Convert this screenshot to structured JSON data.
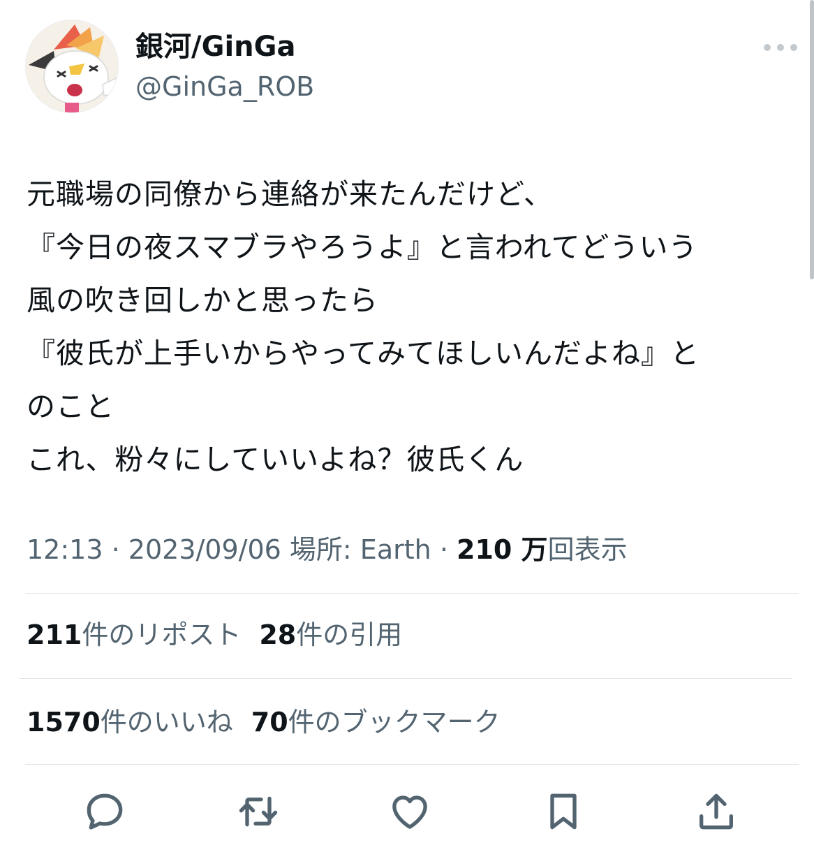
{
  "author": {
    "display_name": "銀河/GinGa",
    "handle": "@GinGa_ROB"
  },
  "tweet": {
    "text": "元職場の同僚から連絡が来たんだけど、\n『今日の夜スマブラやろうよ』と言われてどういう\n風の吹き回しかと思ったら\n『彼氏が上手いからやってみてほしいんだよね』と\nのこと\nこれ、粉々にしていいよね？彼氏くん"
  },
  "meta": {
    "time": "12:13",
    "separator": "·",
    "date": "2023/09/06",
    "location": "場所: Earth",
    "views_count": "210 万",
    "views_label": "回表示"
  },
  "stats": {
    "reposts_count": "211",
    "reposts_label": "件のリポスト",
    "quotes_count": "28",
    "quotes_label": "件の引用",
    "likes_count": "1570",
    "likes_label": "件のいいね",
    "bookmarks_count": "70",
    "bookmarks_label": "件のブックマーク"
  },
  "icons": {
    "more": "more-dots-icon",
    "reply": "reply-icon",
    "retweet": "retweet-icon",
    "like": "heart-icon",
    "bookmark": "bookmark-icon",
    "share": "share-icon"
  },
  "colors": {
    "text": "#0f1419",
    "secondary": "#536471",
    "divider": "#dfe3e6",
    "icon": "#536471"
  }
}
